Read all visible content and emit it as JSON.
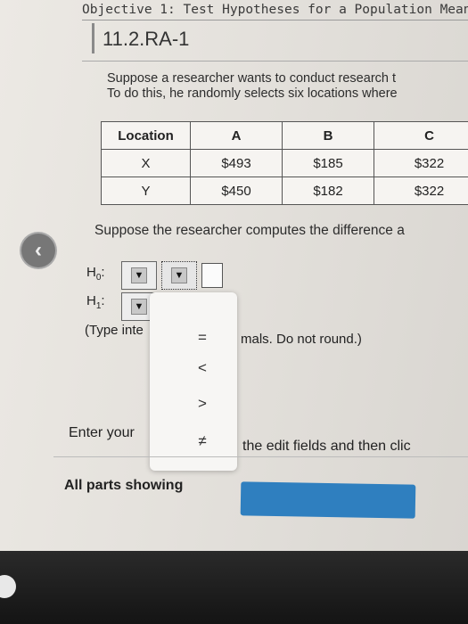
{
  "header": {
    "objective": "Objective 1: Test Hypotheses for a Population Mean",
    "problem_id": "11.2.RA-1"
  },
  "intro": {
    "line1": "Suppose a researcher wants to conduct research t",
    "line2": "To do this, he randomly selects six locations where"
  },
  "table": {
    "headers": [
      "Location",
      "A",
      "B",
      "C"
    ],
    "rows": [
      [
        "X",
        "$493",
        "$185",
        "$322"
      ],
      [
        "Y",
        "$450",
        "$182",
        "$322"
      ]
    ]
  },
  "question": "Suppose the researcher computes the difference a",
  "hypotheses": {
    "h0_prefix": "H",
    "h0_sub": "0",
    "h1_prefix": "H",
    "h1_sub": "1",
    "dropdown_arrow": "▼"
  },
  "hint": {
    "part1": "(Type inte",
    "part2": "mals. Do not round.)"
  },
  "operator_menu": {
    "options": [
      "=",
      "<",
      ">",
      "≠"
    ]
  },
  "instructions": {
    "part1": "Enter your",
    "part2": "the edit fields and then clic"
  },
  "footer": {
    "parts_label": "All parts showing"
  },
  "icons": {
    "back": "chevron-left-icon"
  },
  "colors": {
    "action_button": "#2f7fbf"
  }
}
